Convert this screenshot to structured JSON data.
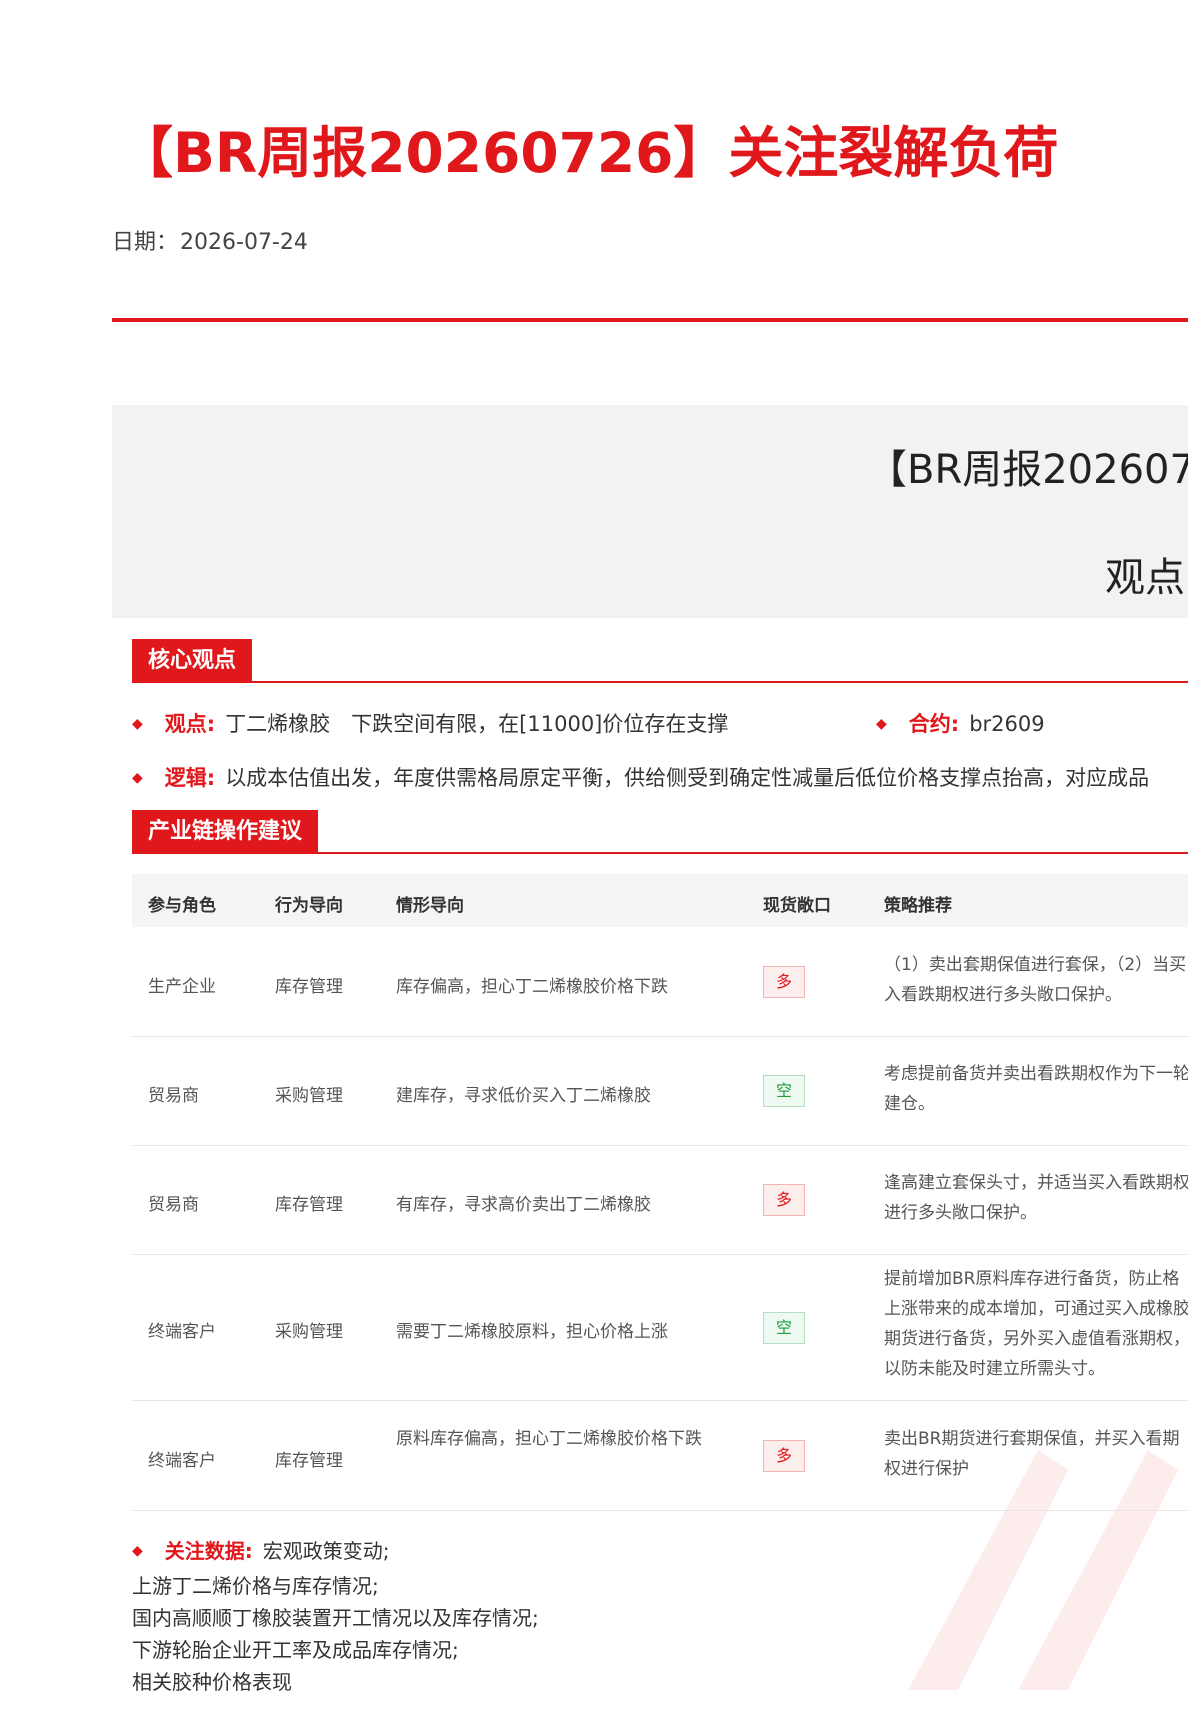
{
  "title": "【BR周报20260726】关注裂解负荷",
  "date": {
    "label": "日期：",
    "value": "2026-07-24"
  },
  "banner": {
    "title": "【BR周报202607",
    "subtitle": "观点"
  },
  "sections": {
    "core": "核心观点",
    "chain": "产业链操作建议"
  },
  "core": {
    "view_label": "观点:",
    "view_text": "丁二烯橡胶　下跌空间有限，在[11000]价位存在支撑",
    "contract_label": "合约:",
    "contract_text": "br2609",
    "logic_label": "逻辑:",
    "logic_text": "以成本估值出发，年度供需格局原定平衡，供给侧受到确定性减量后低位价格支撑点抬高，对应成品"
  },
  "table": {
    "headers": [
      "参与角色",
      "行为导向",
      "情形导向",
      "现货敞口",
      "策略推荐"
    ],
    "rows": [
      {
        "role": "生产企业",
        "behavior": "库存管理",
        "situation": "库存偏高，担心丁二烯橡胶价格下跌",
        "exposure": "多",
        "exposure_type": "long",
        "strategy": "（1）卖出套期保值进行套保，（2）当买入看跌期权进行多头敞口保护。"
      },
      {
        "role": "贸易商",
        "behavior": "采购管理",
        "situation": "建库存，寻求低价买入丁二烯橡胶",
        "exposure": "空",
        "exposure_type": "short",
        "strategy": "考虑提前备货并卖出看跌期权作为下一轮建仓。"
      },
      {
        "role": "贸易商",
        "behavior": "库存管理",
        "situation": "有库存，寻求高价卖出丁二烯橡胶",
        "exposure": "多",
        "exposure_type": "long",
        "strategy": "逢高建立套保头寸，并适当买入看跌期权进行多头敞口保护。"
      },
      {
        "role": "终端客户",
        "behavior": "采购管理",
        "situation": "需要丁二烯橡胶原料，担心价格上涨",
        "exposure": "空",
        "exposure_type": "short",
        "strategy": "提前增加BR原料库存进行备货，防止格上涨带来的成本增加，可通过买入成橡胶期货进行备货，另外买入虚值看涨期权，以防未能及时建立所需头寸。"
      },
      {
        "role": "终端客户",
        "behavior": "库存管理",
        "situation": "原料库存偏高，担心丁二烯橡胶价格下跌",
        "exposure": "多",
        "exposure_type": "long",
        "strategy": "卖出BR期货进行套期保值，并买入看期权进行保护"
      }
    ]
  },
  "focus": {
    "label": "关注数据:",
    "items": [
      "宏观政策变动;",
      "上游丁二烯价格与库存情况;",
      "国内高顺顺丁橡胶装置开工情况以及库存情况;",
      "下游轮胎企业开工率及成品库存情况;",
      "相关胶种价格表现"
    ]
  }
}
